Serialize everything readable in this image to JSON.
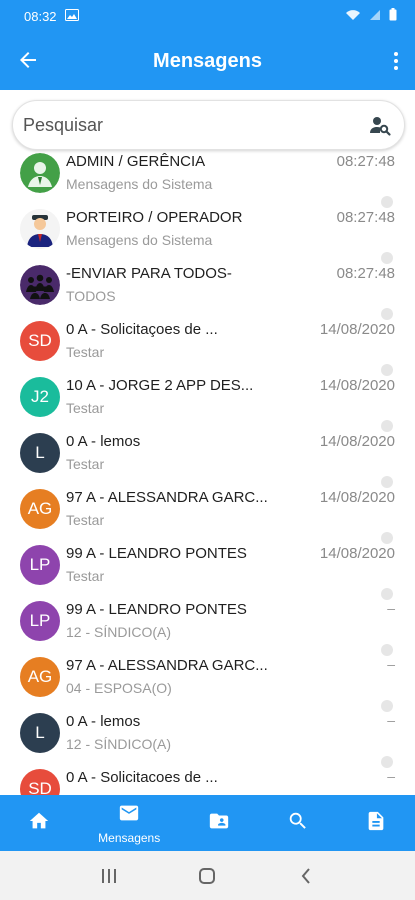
{
  "status": {
    "time": "08:32"
  },
  "header": {
    "title": "Mensagens"
  },
  "search": {
    "placeholder": "Pesquisar"
  },
  "messages": [
    {
      "name": "ADMIN / GERÊNCIA",
      "sub": "Mensagens do Sistema",
      "date": "08:27:48",
      "avatar_type": "image",
      "avatar_icon": "admin-avatar-icon"
    },
    {
      "name": "PORTEIRO / OPERADOR",
      "sub": "Mensagens do Sistema",
      "date": "08:27:48",
      "avatar_type": "image",
      "avatar_icon": "doorman-avatar-icon"
    },
    {
      "name": "-ENVIAR PARA TODOS-",
      "sub": "TODOS",
      "date": "08:27:48",
      "avatar_type": "image",
      "avatar_icon": "group-avatar-icon"
    },
    {
      "name": "0 A - Solicitaçoes de ...",
      "sub": "Testar",
      "date": "14/08/2020",
      "initials": "SD",
      "color": "#e74c3c"
    },
    {
      "name": "10 A - JORGE 2 APP DES...",
      "sub": "Testar",
      "date": "14/08/2020",
      "initials": "J2",
      "color": "#1abc9c"
    },
    {
      "name": "0 A - lemos",
      "sub": "Testar",
      "date": "14/08/2020",
      "initials": "L",
      "color": "#2c3e50"
    },
    {
      "name": "97 A - ALESSANDRA GARC...",
      "sub": "Testar",
      "date": "14/08/2020",
      "initials": "AG",
      "color": "#e67e22"
    },
    {
      "name": "99 A - LEANDRO PONTES",
      "sub": "Testar",
      "date": "14/08/2020",
      "initials": "LP",
      "color": "#8e44ad"
    },
    {
      "name": "99 A - LEANDRO PONTES",
      "sub": "12 - SÍNDICO(A)",
      "date": "",
      "initials": "LP",
      "color": "#8e44ad",
      "dash": "–"
    },
    {
      "name": "97 A - ALESSANDRA GARC...",
      "sub": "04 - ESPOSA(O)",
      "date": "",
      "initials": "AG",
      "color": "#e67e22",
      "dash": "–"
    },
    {
      "name": "0 A - lemos",
      "sub": "12 - SÍNDICO(A)",
      "date": "",
      "initials": "L",
      "color": "#2c3e50",
      "dash": "–"
    },
    {
      "name": "0 A - Solicitacoes de ...",
      "sub": "",
      "date": "",
      "initials": "SD",
      "color": "#e74c3c",
      "dash": "–"
    }
  ],
  "bottom_nav": [
    {
      "icon": "home-icon",
      "label": ""
    },
    {
      "icon": "mail-icon",
      "label": "Mensagens"
    },
    {
      "icon": "contacts-folder-icon",
      "label": ""
    },
    {
      "icon": "search-icon",
      "label": ""
    },
    {
      "icon": "document-icon",
      "label": ""
    }
  ],
  "colors": {
    "primary": "#2196f3",
    "divider_dot": "#e6e6e6"
  }
}
